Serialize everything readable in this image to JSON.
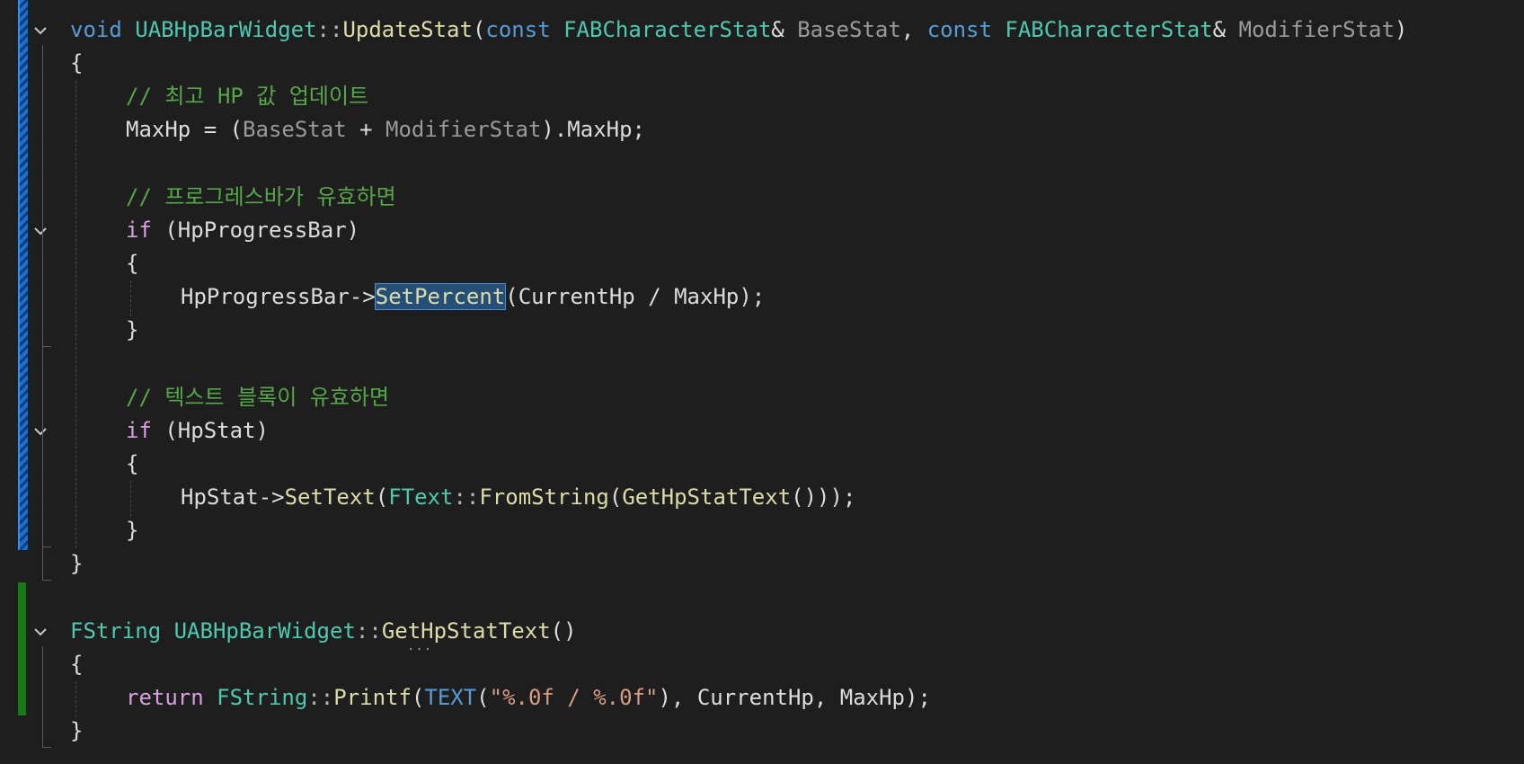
{
  "code": {
    "l1": {
      "kw_void": "void",
      "cls": "UABHpBarWidget",
      "sep": "::",
      "fn": "UpdateStat",
      "open": "(",
      "kw_const1": "const",
      "type1": "FABCharacterStat",
      "amp1": "& ",
      "p1": "BaseStat",
      "comma": ", ",
      "kw_const2": "const",
      "type2": "FABCharacterStat",
      "amp2": "& ",
      "p2": "ModifierStat",
      "close": ")"
    },
    "l2": "{",
    "l3": "// 최고 HP 값 업데이트",
    "l4": {
      "a": "MaxHp = (",
      "p1": "BaseStat",
      "b": " + ",
      "p2": "ModifierStat",
      "c": ").MaxHp;"
    },
    "l6": "// 프로그레스바가 유효하면",
    "l7": {
      "kw": "if",
      "rest": " (HpProgressBar)"
    },
    "l8": "{",
    "l9": {
      "a": "HpProgressBar->",
      "sel": "SetPercent",
      "b": "(CurrentHp / MaxHp);"
    },
    "l10": "}",
    "l12": "// 텍스트 블록이 유효하면",
    "l13": {
      "kw": "if",
      "rest": " (HpStat)"
    },
    "l14": "{",
    "l15": {
      "a": "HpStat->",
      "fn1": "SetText",
      "b": "(",
      "type": "FText",
      "sep": "::",
      "fn2": "FromString",
      "c": "(",
      "fn3": "GetHpStatText",
      "d": "()));"
    },
    "l16": "}",
    "l17": "}",
    "l19": {
      "type": "FString",
      "cls": "UABHpBarWidget",
      "sep": "::",
      "fn": "GetHpStatText",
      "rest": "()"
    },
    "l20": "{",
    "l21": {
      "kw": "return",
      "sp": " ",
      "type": "FString",
      "sep": "::",
      "fn": "Printf",
      "o": "(",
      "mac": "TEXT",
      "o2": "(",
      "str": "\"%.0f / %.0f\"",
      "rest": "), CurrentHp, MaxHp);"
    },
    "l22": "}",
    "dots": "..."
  },
  "icons": {
    "fold": "chevron-down-icon"
  },
  "colors": {
    "keyword": "#569cd6",
    "control": "#d8a0df",
    "type": "#4ec9b0",
    "function": "#dcdcaa",
    "comment": "#57a64a",
    "string": "#d69d85",
    "modified": "#1a6fd0",
    "added": "#167a16"
  }
}
